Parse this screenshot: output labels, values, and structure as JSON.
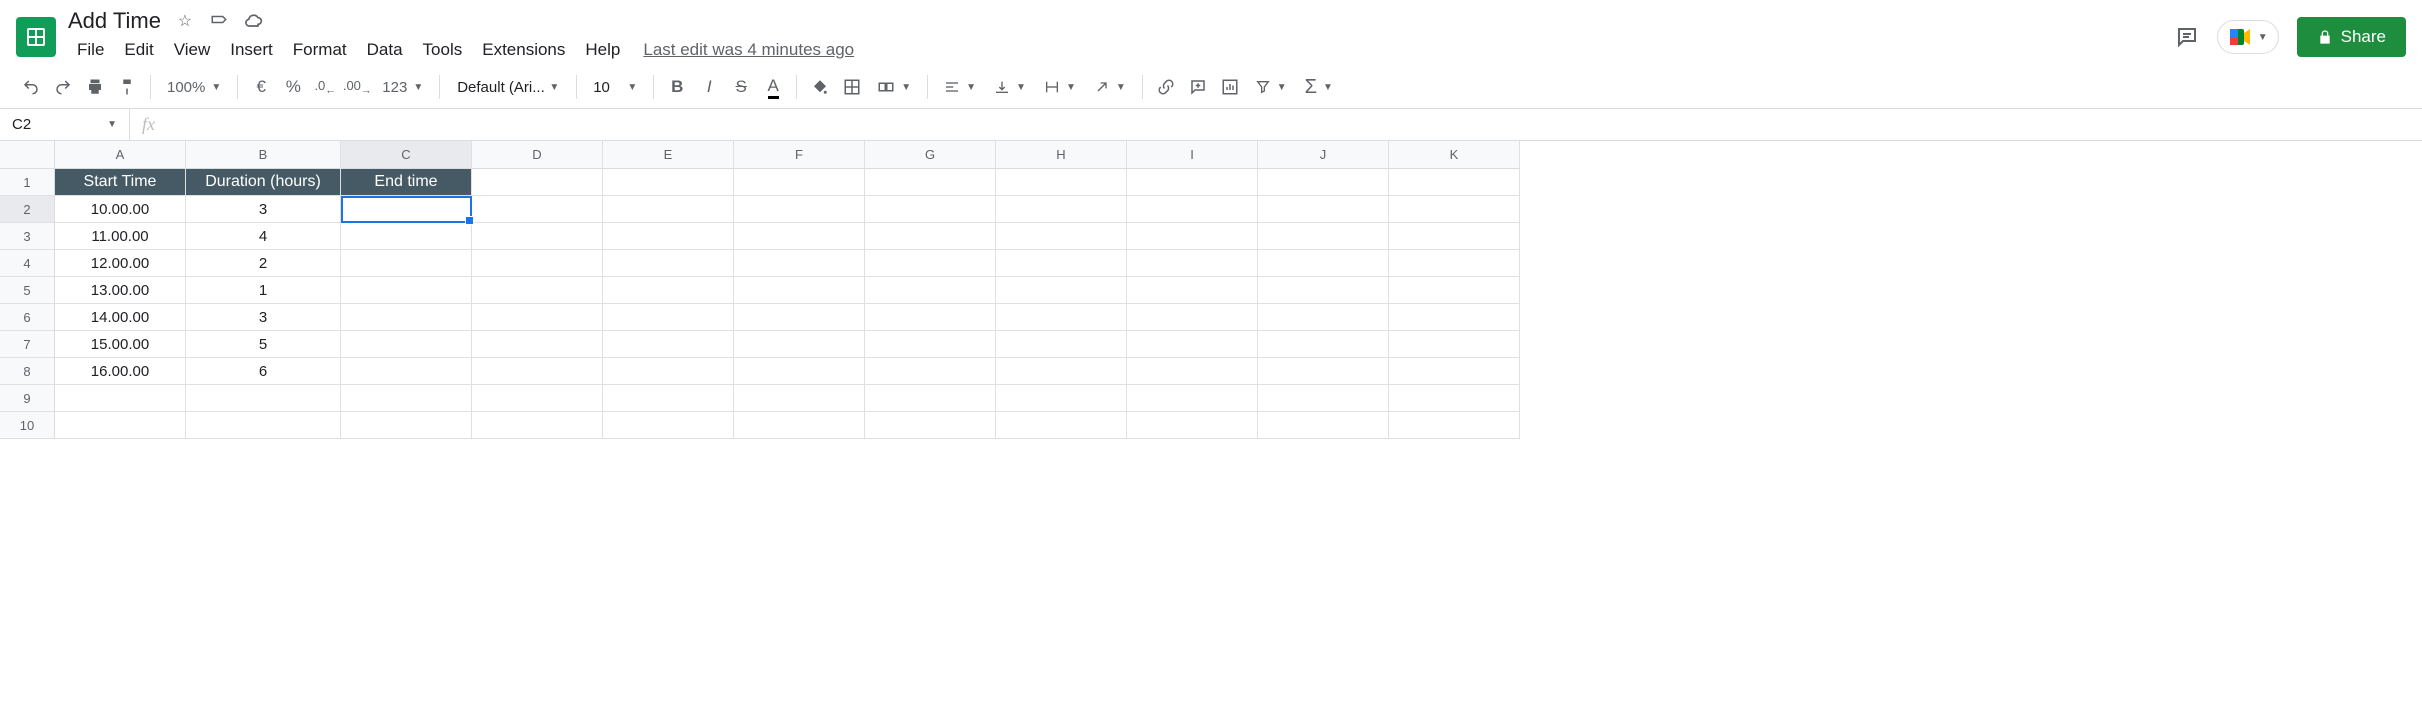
{
  "doc": {
    "title": "Add Time"
  },
  "menus": [
    "File",
    "Edit",
    "View",
    "Insert",
    "Format",
    "Data",
    "Tools",
    "Extensions",
    "Help"
  ],
  "last_edit": "Last edit was 4 minutes ago",
  "share": "Share",
  "toolbar": {
    "zoom": "100%",
    "currency": "€",
    "percent": "%",
    "dec_dec": ".0",
    "inc_dec": ".00",
    "more_fmt": "123",
    "font": "Default (Ari...",
    "font_size": "10"
  },
  "namebox": "C2",
  "formula": "",
  "columns": [
    "A",
    "B",
    "C",
    "D",
    "E",
    "F",
    "G",
    "H",
    "I",
    "J",
    "K"
  ],
  "rows": [
    "1",
    "2",
    "3",
    "4",
    "5",
    "6",
    "7",
    "8",
    "9",
    "10"
  ],
  "selected_cell": "C2",
  "chart_data": {
    "type": "table",
    "headers": [
      "Start Time",
      "Duration (hours)",
      "End time"
    ],
    "data": [
      [
        "10.00.00",
        "3",
        ""
      ],
      [
        "11.00.00",
        "4",
        ""
      ],
      [
        "12.00.00",
        "2",
        ""
      ],
      [
        "13.00.00",
        "1",
        ""
      ],
      [
        "14.00.00",
        "3",
        ""
      ],
      [
        "15.00.00",
        "5",
        ""
      ],
      [
        "16.00.00",
        "6",
        ""
      ]
    ]
  }
}
